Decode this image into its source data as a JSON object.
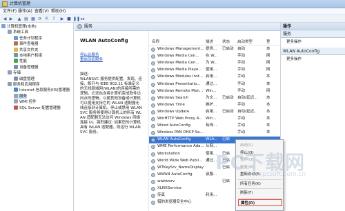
{
  "window": {
    "title": "计算机管理"
  },
  "menu": [
    "文件(F)",
    "操作(A)",
    "查看(V)",
    "帮助(H)"
  ],
  "tree": [
    {
      "label": "计算机管理(本地)",
      "indent": 0,
      "color": "#7aa3d6"
    },
    {
      "label": "系统工具",
      "indent": 1,
      "color": "#8aa0b8"
    },
    {
      "label": "任务计划程序",
      "indent": 2,
      "color": "#6b9bd1"
    },
    {
      "label": "事件查看器",
      "indent": 2,
      "color": "#b06f4d"
    },
    {
      "label": "共享文件夹",
      "indent": 2,
      "color": "#e0b54a"
    },
    {
      "label": "本地用户和组",
      "indent": 2,
      "color": "#7b8fa8"
    },
    {
      "label": "性能",
      "indent": 2,
      "color": "#4f9e57"
    },
    {
      "label": "设备管理器",
      "indent": 2,
      "color": "#7b8fa8"
    },
    {
      "label": "存储",
      "indent": 1,
      "color": "#8aa0b8"
    },
    {
      "label": "磁盘管理",
      "indent": 2,
      "color": "#7b8fa8"
    },
    {
      "label": "服务和应用程序",
      "indent": 1,
      "color": "#8aa0b8"
    },
    {
      "label": "Internet 信息服务(IIS)管理器",
      "indent": 2,
      "color": "#4d86c9"
    },
    {
      "label": "服务",
      "indent": 2,
      "color": "#9aa5b2",
      "selected": true
    },
    {
      "label": "WMI 控件",
      "indent": 2,
      "color": "#9aa5b2"
    },
    {
      "label": "SQL Server 配置管理器",
      "indent": 2,
      "color": "#c25a4a"
    }
  ],
  "content": {
    "header": "服务",
    "desc_title": "WLAN AutoConfig",
    "links": [
      "停止此服务",
      "重启动此服务"
    ],
    "desc_label": "描述:",
    "desc_text": "WLANSVC 服务提供配置、发现、连接、断开与 IEEE 802.11 标准定义的无线局域网(WLAN)的连接所需的逻辑。它还包含将计算机变成软件访问点的逻辑，以便其他设备或计算机可以使用支持它的 WLAN 适配器无线连接到计算机。停止或禁用 WLANSVC 服务将使得计算机上的所有 WLAN 适配器无法访问 Windows 网络连接 UI。强烈建议: 如果您的计算机具有 WLAN 适配器，则运行 WLANSVC 服务。"
  },
  "columns": [
    "名称",
    "描述",
    "状态",
    "启动类型",
    "登"
  ],
  "services": [
    {
      "name": "Windows Management...",
      "desc": "提供...",
      "status": "已启动",
      "start": "自动",
      "logon": "本"
    },
    {
      "name": "Windows Media Cen...",
      "desc": "在 W...",
      "status": "",
      "start": "手动",
      "logon": "网"
    },
    {
      "name": "Windows Media Cen...",
      "desc": "为 W...",
      "status": "",
      "start": "手动",
      "logon": "网"
    },
    {
      "name": "Windows Media Playe...",
      "desc": "使用...",
      "status": "",
      "start": "手动",
      "logon": "网"
    },
    {
      "name": "Windows Modules Inst...",
      "desc": "启用...",
      "status": "",
      "start": "手动",
      "logon": "本"
    },
    {
      "name": "Windows Presentatio...",
      "desc": "通过...",
      "status": "",
      "start": "手动",
      "logon": "本"
    },
    {
      "name": "Windows Remote Man...",
      "desc": "Win...",
      "status": "",
      "start": "手动",
      "logon": "网"
    },
    {
      "name": "Windows Search",
      "desc": "为文...",
      "status": "已启动",
      "start": "自动(延迟...",
      "logon": "本"
    },
    {
      "name": "Windows Time",
      "desc": "维护...",
      "status": "",
      "start": "手动",
      "logon": "本"
    },
    {
      "name": "Windows Update",
      "desc": "启用...",
      "status": "已启动",
      "start": "自动(延迟...",
      "logon": "本"
    },
    {
      "name": "WinHTTP Web Proxy A...",
      "desc": "Win...",
      "status": "",
      "start": "手动",
      "logon": "本"
    },
    {
      "name": "Wired AutoConfig",
      "desc": "有线...",
      "status": "",
      "start": "手动",
      "logon": "本"
    },
    {
      "name": "Wireless PAN DHCP Se...",
      "desc": "",
      "status": "",
      "start": "手动",
      "logon": "本"
    },
    {
      "name": "WLAN AutoConfig",
      "desc": "WLA...",
      "status": "已启",
      "start": "",
      "logon": "",
      "selected": true
    },
    {
      "name": "WME Performance Ada...",
      "desc": "从网...",
      "status": "",
      "start": "",
      "logon": ""
    },
    {
      "name": "Workstation",
      "desc": "使用...",
      "status": "已启",
      "start": "",
      "logon": ""
    },
    {
      "name": "World Wide Web Publi...",
      "desc": "通过...",
      "status": "已启",
      "start": "",
      "logon": ""
    },
    {
      "name": "WTKeySrv_NameDisplay",
      "desc": "",
      "status": "已启",
      "start": "",
      "logon": ""
    },
    {
      "name": "WWAN AutoConfig",
      "desc": "该服...",
      "status": "",
      "start": "",
      "logon": ""
    },
    {
      "name": "wwbizsrv",
      "desc": "",
      "status": "已启",
      "start": "",
      "logon": ""
    },
    {
      "name": "XLNXService",
      "desc": "",
      "status": "",
      "start": "",
      "logon": ""
    },
    {
      "name": "传真",
      "desc": "利用...",
      "status": "",
      "start": "",
      "logon": ""
    },
    {
      "name": "猎豹浏览器安全中心",
      "desc": "",
      "status": "",
      "start": "",
      "logon": ""
    }
  ],
  "actions": {
    "section1": "操作",
    "section1_sub": "服务",
    "section1_items": [
      "更多操作"
    ],
    "section2": "WLAN AutoConfig",
    "section2_items": [
      "更多操作"
    ]
  },
  "context_menu": [
    {
      "label": "启动(S)",
      "disabled": true
    },
    {
      "label": "停止(O)"
    },
    {
      "label": "暂停(U)",
      "disabled": true
    },
    {
      "label": "恢复(M)",
      "disabled": true
    },
    {
      "label": "重新启动(E)"
    },
    {
      "sep": true
    },
    {
      "label": "所有任务(K)"
    },
    {
      "sep": true
    },
    {
      "label": "刷新(F)"
    },
    {
      "sep": true
    },
    {
      "label": "属性(R)",
      "highlight": true
    }
  ],
  "watermark": {
    "main": "PC下载网",
    "sub": "www.pcsoft.com.cn"
  }
}
